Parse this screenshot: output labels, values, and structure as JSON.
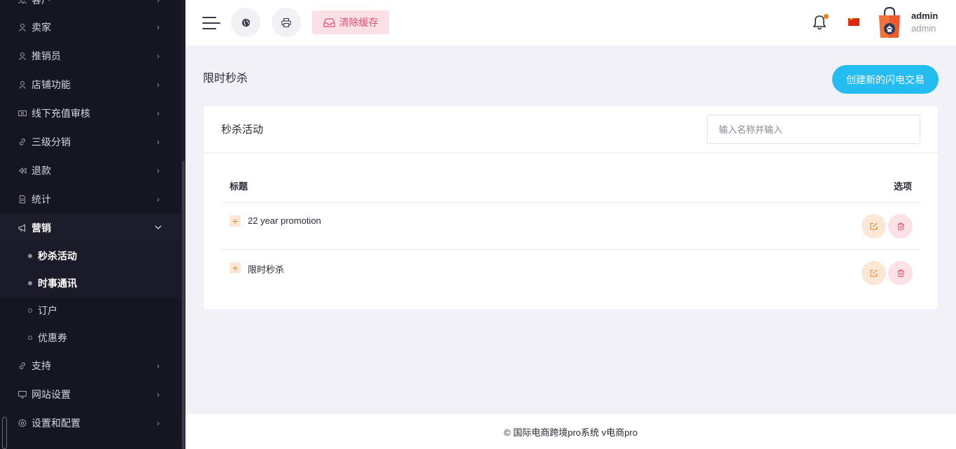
{
  "sidebar": {
    "items": [
      {
        "label": "客户",
        "icon": "users-icon"
      },
      {
        "label": "卖家",
        "icon": "user-icon"
      },
      {
        "label": "推销员",
        "icon": "user-icon"
      },
      {
        "label": "店铺功能",
        "icon": "user-icon"
      },
      {
        "label": "线下充值审核",
        "icon": "money-icon"
      },
      {
        "label": "三级分销",
        "icon": "link-icon"
      },
      {
        "label": "退款",
        "icon": "rewind-icon"
      },
      {
        "label": "统计",
        "icon": "file-icon"
      },
      {
        "label": "营销",
        "icon": "megaphone-icon"
      },
      {
        "label": "支持",
        "icon": "link-icon"
      },
      {
        "label": "网站设置",
        "icon": "desktop-icon"
      },
      {
        "label": "设置和配置",
        "icon": "settings-icon"
      }
    ],
    "submenu": [
      {
        "label": "秒杀活动"
      },
      {
        "label": "时事通讯"
      },
      {
        "label": "订户"
      },
      {
        "label": "优惠券"
      }
    ]
  },
  "header": {
    "clear_cache_label": "清除缓存",
    "user_name": "admin",
    "user_role": "admin"
  },
  "main": {
    "page_title": "限时秒杀",
    "create_button_label": "创建新的闪电交易",
    "card_title": "秒杀活动",
    "search_placeholder": "输入名称并输入",
    "table": {
      "columns": [
        "标题",
        "选项"
      ],
      "rows": [
        {
          "title": "22 year promotion"
        },
        {
          "title": "限时秒杀"
        }
      ]
    }
  },
  "footer": {
    "text": "© 国际电商跨境pro系统 v电商pro"
  },
  "colors": {
    "sidebar_bg": "#161622",
    "accent": "#25bcf1",
    "danger": "#e3506e",
    "warning": "#f0832a"
  }
}
